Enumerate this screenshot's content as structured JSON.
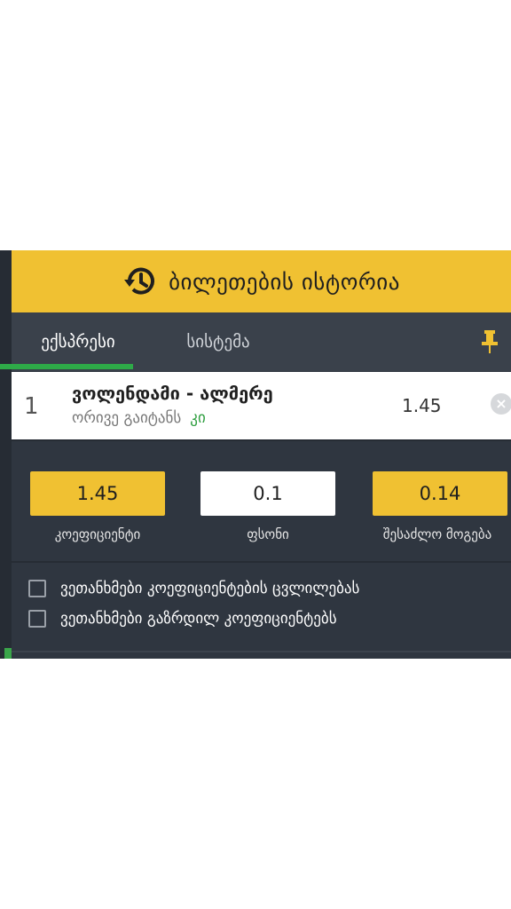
{
  "header": {
    "title": "ბილეთების ისტორია",
    "icon": "history-icon"
  },
  "tabs": [
    {
      "label": "ექსპრესი",
      "active": true
    },
    {
      "label": "სისტემა",
      "active": false
    }
  ],
  "pin_icon": "pin-icon",
  "bet": {
    "index": "1",
    "match": "ვოლენდამი - ალმერე",
    "market": "ორივე გაიტანს",
    "pick": "კი",
    "odd": "1.45"
  },
  "summary": {
    "coefficient": {
      "value": "1.45",
      "label": "კოეფიციენტი"
    },
    "stake": {
      "value": "0.1",
      "label": "ფსონი"
    },
    "payout": {
      "value": "0.14",
      "label": "შესაძლო მოგება"
    }
  },
  "options": [
    {
      "label": "ვეთანხმები კოეფიციენტების ცვლილებას",
      "checked": false
    },
    {
      "label": "ვეთანხმები გაზრდილ კოეფიციენტებს",
      "checked": false
    }
  ],
  "colors": {
    "accent": "#f0c132",
    "background": "#2f3640",
    "active_tab": "#2eaa48",
    "pick": "#2e9e3f"
  }
}
